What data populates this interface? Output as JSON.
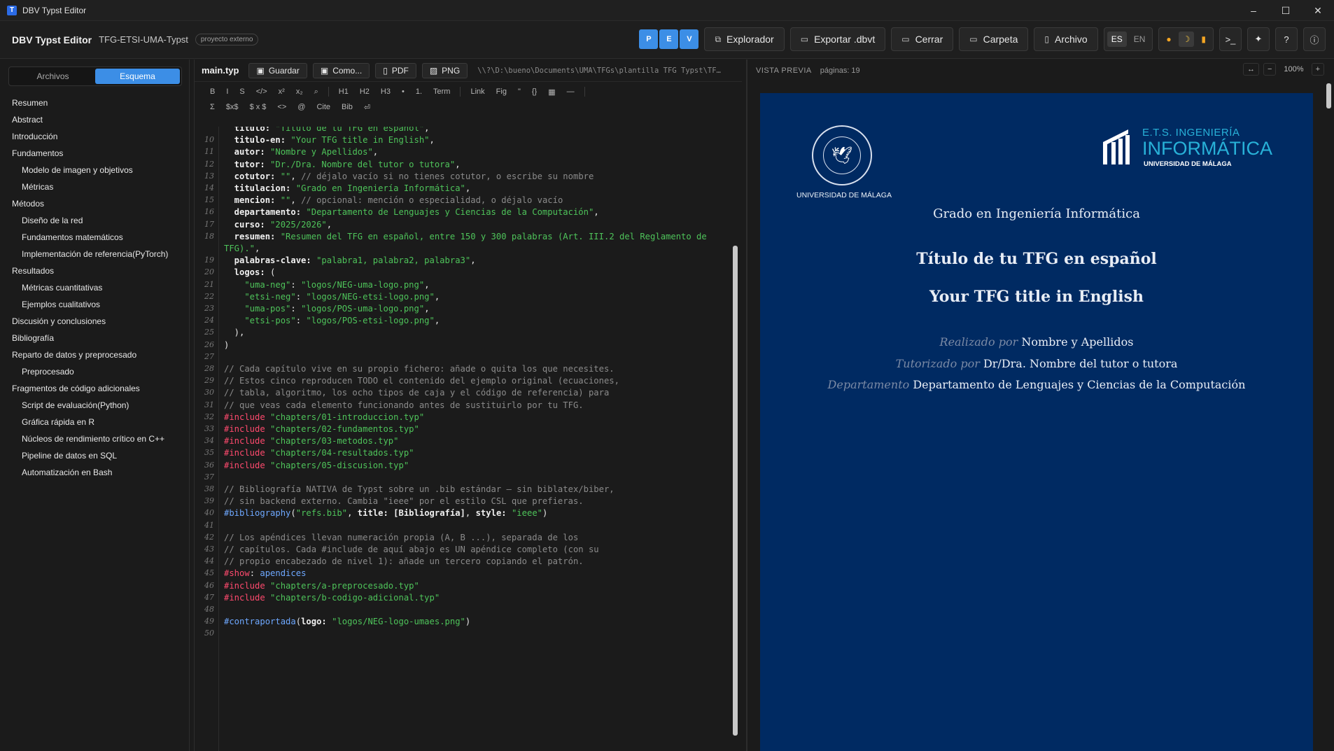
{
  "window": {
    "title": "DBV Typst Editor",
    "icon_letter": "T",
    "minimize": "–",
    "maximize": "☐",
    "close": "✕"
  },
  "toolbar": {
    "app_name": "DBV Typst Editor",
    "project": "TFG-ETSI-UMA-Typst",
    "badge": "proyecto externo",
    "pev": [
      "P",
      "E",
      "V"
    ],
    "explorer": "Explorador",
    "export": "Exportar .dbvt",
    "close": "Cerrar",
    "folder": "Carpeta",
    "file": "Archivo",
    "lang_es": "ES",
    "lang_en": "EN",
    "terminal": ">_",
    "ai": "✦",
    "help": "?",
    "info": "ⓘ"
  },
  "sidebar": {
    "tab_files": "Archivos",
    "tab_outline": "Esquema",
    "outline": [
      {
        "label": "Resumen",
        "level": 1
      },
      {
        "label": "Abstract",
        "level": 1
      },
      {
        "label": "Introducción",
        "level": 1
      },
      {
        "label": "Fundamentos",
        "level": 1
      },
      {
        "label": "Modelo de imagen y objetivos",
        "level": 2
      },
      {
        "label": "Métricas",
        "level": 2
      },
      {
        "label": "Métodos",
        "level": 1
      },
      {
        "label": "Diseño de la red",
        "level": 2
      },
      {
        "label": "Fundamentos matemáticos",
        "level": 2
      },
      {
        "label": "Implementación de referencia(PyTorch)",
        "level": 2
      },
      {
        "label": "Resultados",
        "level": 1
      },
      {
        "label": "Métricas cuantitativas",
        "level": 2
      },
      {
        "label": "Ejemplos cualitativos",
        "level": 2
      },
      {
        "label": "Discusión y conclusiones",
        "level": 1
      },
      {
        "label": "Bibliografía",
        "level": 1
      },
      {
        "label": "Reparto de datos y preprocesado",
        "level": 1
      },
      {
        "label": "Preprocesado",
        "level": 2
      },
      {
        "label": "Fragmentos de código adicionales",
        "level": 1
      },
      {
        "label": "Script de evaluación(Python)",
        "level": 2
      },
      {
        "label": "Gráfica rápida en R",
        "level": 2
      },
      {
        "label": "Núcleos de rendimiento crítico en C++",
        "level": 2
      },
      {
        "label": "Pipeline de datos en SQL",
        "level": 2
      },
      {
        "label": "Automatización en Bash",
        "level": 2
      }
    ]
  },
  "editor": {
    "filename": "main.typ",
    "save": "Guardar",
    "save_as": "Como...",
    "pdf": "PDF",
    "png": "PNG",
    "path": "\\\\?\\D:\\bueno\\Documents\\UMA\\TFGs\\plantilla TFG Typst\\TF…",
    "format_row1": [
      "B",
      "I",
      "S",
      "</>",
      "x²",
      "x₂",
      "⌕",
      "|",
      "H1",
      "H2",
      "H3",
      "•",
      "1.",
      "Term",
      "|",
      "Link",
      "Fig",
      "\"",
      "{}",
      "▦",
      "—",
      "|"
    ],
    "format_row2": [
      "Σ",
      "$x$",
      "$ x $",
      "<>",
      "@",
      "Cite",
      "Bib",
      "⏎"
    ],
    "lines": [
      {
        "n": "",
        "seg": [
          [
            "k",
            "  titulo: "
          ],
          [
            "s",
            "\"Título de tu TFG en español\""
          ],
          [
            "",
            ","
          ]
        ]
      },
      {
        "n": "10",
        "seg": [
          [
            "k",
            "  titulo-en: "
          ],
          [
            "s",
            "\"Your TFG title in English\""
          ],
          [
            "",
            ","
          ]
        ]
      },
      {
        "n": "11",
        "seg": [
          [
            "k",
            "  autor: "
          ],
          [
            "s",
            "\"Nombre y Apellidos\""
          ],
          [
            "",
            ","
          ]
        ]
      },
      {
        "n": "12",
        "seg": [
          [
            "k",
            "  tutor: "
          ],
          [
            "s",
            "\"Dr./Dra. Nombre del tutor o tutora\""
          ],
          [
            "",
            ","
          ]
        ]
      },
      {
        "n": "13",
        "seg": [
          [
            "k",
            "  cotutor: "
          ],
          [
            "s",
            "\"\""
          ],
          [
            "",
            ", "
          ],
          [
            "c",
            "// déjalo vacío si no tienes cotutor, o escribe su nombre"
          ]
        ]
      },
      {
        "n": "14",
        "seg": [
          [
            "k",
            "  titulacion: "
          ],
          [
            "s",
            "\"Grado en Ingeniería Informática\""
          ],
          [
            "",
            ","
          ]
        ]
      },
      {
        "n": "15",
        "seg": [
          [
            "k",
            "  mencion: "
          ],
          [
            "s",
            "\"\""
          ],
          [
            "",
            ", "
          ],
          [
            "c",
            "// opcional: mención o especialidad, o déjalo vacío"
          ]
        ]
      },
      {
        "n": "16",
        "seg": [
          [
            "k",
            "  departamento: "
          ],
          [
            "s",
            "\"Departamento de Lenguajes y Ciencias de la Computación\""
          ],
          [
            "",
            ","
          ]
        ]
      },
      {
        "n": "17",
        "seg": [
          [
            "k",
            "  curso: "
          ],
          [
            "s",
            "\"2025/2026\""
          ],
          [
            "",
            ","
          ]
        ]
      },
      {
        "n": "18",
        "seg": [
          [
            "k",
            "  resumen: "
          ],
          [
            "s",
            "\"Resumen del TFG en español, entre 150 y 300 palabras (Art. III.2 del Reglamento de"
          ]
        ]
      },
      {
        "n": "",
        "seg": [
          [
            "s",
            "TFG).\""
          ],
          [
            "",
            ","
          ]
        ]
      },
      {
        "n": "19",
        "seg": [
          [
            "k",
            "  palabras-clave: "
          ],
          [
            "s",
            "\"palabra1, palabra2, palabra3\""
          ],
          [
            "",
            ","
          ]
        ]
      },
      {
        "n": "20",
        "seg": [
          [
            "k",
            "  logos: "
          ],
          [
            "",
            "("
          ]
        ]
      },
      {
        "n": "21",
        "seg": [
          [
            "s",
            "    \"uma-neg\""
          ],
          [
            "",
            ": "
          ],
          [
            "s",
            "\"logos/NEG-uma-logo.png\""
          ],
          [
            "",
            ","
          ]
        ]
      },
      {
        "n": "22",
        "seg": [
          [
            "s",
            "    \"etsi-neg\""
          ],
          [
            "",
            ": "
          ],
          [
            "s",
            "\"logos/NEG-etsi-logo.png\""
          ],
          [
            "",
            ","
          ]
        ]
      },
      {
        "n": "23",
        "seg": [
          [
            "s",
            "    \"uma-pos\""
          ],
          [
            "",
            ": "
          ],
          [
            "s",
            "\"logos/POS-uma-logo.png\""
          ],
          [
            "",
            ","
          ]
        ]
      },
      {
        "n": "24",
        "seg": [
          [
            "s",
            "    \"etsi-pos\""
          ],
          [
            "",
            ": "
          ],
          [
            "s",
            "\"logos/POS-etsi-logo.png\""
          ],
          [
            "",
            ","
          ]
        ]
      },
      {
        "n": "25",
        "seg": [
          [
            "",
            "  ),"
          ]
        ]
      },
      {
        "n": "26",
        "seg": [
          [
            "",
            ")"
          ]
        ]
      },
      {
        "n": "27",
        "seg": []
      },
      {
        "n": "28",
        "seg": [
          [
            "c",
            "// Cada capítulo vive en su propio fichero: añade o quita los que necesites."
          ]
        ]
      },
      {
        "n": "29",
        "seg": [
          [
            "c",
            "// Estos cinco reproducen TODO el contenido del ejemplo original (ecuaciones,"
          ]
        ]
      },
      {
        "n": "30",
        "seg": [
          [
            "c",
            "// tabla, algoritmo, los ocho tipos de caja y el código de referencia) para"
          ]
        ]
      },
      {
        "n": "31",
        "seg": [
          [
            "c",
            "// que veas cada elemento funcionando antes de sustituirlo por tu TFG."
          ]
        ]
      },
      {
        "n": "32",
        "seg": [
          [
            "h",
            "#include "
          ],
          [
            "s",
            "\"chapters/01-introduccion.typ\""
          ]
        ]
      },
      {
        "n": "33",
        "seg": [
          [
            "h",
            "#include "
          ],
          [
            "s",
            "\"chapters/02-fundamentos.typ\""
          ]
        ]
      },
      {
        "n": "34",
        "seg": [
          [
            "h",
            "#include "
          ],
          [
            "s",
            "\"chapters/03-metodos.typ\""
          ]
        ]
      },
      {
        "n": "35",
        "seg": [
          [
            "h",
            "#include "
          ],
          [
            "s",
            "\"chapters/04-resultados.typ\""
          ]
        ]
      },
      {
        "n": "36",
        "seg": [
          [
            "h",
            "#include "
          ],
          [
            "s",
            "\"chapters/05-discusion.typ\""
          ]
        ]
      },
      {
        "n": "37",
        "seg": []
      },
      {
        "n": "38",
        "seg": [
          [
            "c",
            "// Bibliografía NATIVA de Typst sobre un .bib estándar — sin biblatex/biber,"
          ]
        ]
      },
      {
        "n": "39",
        "seg": [
          [
            "c",
            "// sin backend externo. Cambia \"ieee\" por el estilo CSL que prefieras."
          ]
        ]
      },
      {
        "n": "40",
        "seg": [
          [
            "fn",
            "#bibliography"
          ],
          [
            "",
            "("
          ],
          [
            "s",
            "\"refs.bib\""
          ],
          [
            "",
            ", "
          ],
          [
            "k",
            "title: "
          ],
          [
            "k",
            "[Bibliografía]"
          ],
          [
            "",
            ", "
          ],
          [
            "k",
            "style: "
          ],
          [
            "s",
            "\"ieee\""
          ],
          [
            "",
            ")"
          ]
        ]
      },
      {
        "n": "41",
        "seg": []
      },
      {
        "n": "42",
        "seg": [
          [
            "c",
            "// Los apéndices llevan numeración propia (A, B ...), separada de los"
          ]
        ]
      },
      {
        "n": "43",
        "seg": [
          [
            "c",
            "// capítulos. Cada #include de aquí abajo es UN apéndice completo (con su"
          ]
        ]
      },
      {
        "n": "44",
        "seg": [
          [
            "c",
            "// propio encabezado de nivel 1): añade un tercero copiando el patrón."
          ]
        ]
      },
      {
        "n": "45",
        "seg": [
          [
            "h",
            "#show"
          ],
          [
            "",
            ": "
          ],
          [
            "fn",
            "apendices"
          ]
        ]
      },
      {
        "n": "46",
        "seg": [
          [
            "h",
            "#include "
          ],
          [
            "s",
            "\"chapters/a-preprocesado.typ\""
          ]
        ]
      },
      {
        "n": "47",
        "seg": [
          [
            "h",
            "#include "
          ],
          [
            "s",
            "\"chapters/b-codigo-adicional.typ\""
          ]
        ]
      },
      {
        "n": "48",
        "seg": []
      },
      {
        "n": "49",
        "seg": [
          [
            "fn",
            "#contraportada"
          ],
          [
            "",
            "("
          ],
          [
            "k",
            "logo: "
          ],
          [
            "s",
            "\"logos/NEG-logo-umaes.png\""
          ],
          [
            "",
            ")"
          ]
        ]
      },
      {
        "n": "50",
        "seg": []
      }
    ]
  },
  "preview": {
    "label": "VISTA PREVIA",
    "pages": "páginas: 19",
    "zoom": "100%",
    "fit": "↔",
    "zoom_out": "−",
    "zoom_in": "+",
    "page_bg": "#002a62",
    "uma_name": "UNIVERSIDAD DE MÁLAGA",
    "etsi_line1": "E.T.S. INGENIERÍA",
    "etsi_line2": "INFORMÁTICA",
    "etsi_line3": "UNIVERSIDAD DE MÁLAGA",
    "grado": "Grado en Ingeniería Informática",
    "title_es": "Título de tu TFG en español",
    "title_en": "Your TFG title in English",
    "realizado_label": "Realizado por",
    "realizado_value": "Nombre y Apellidos",
    "tutorizado_label": "Tutorizado por",
    "tutorizado_value": "Dr/Dra. Nombre del tutor o tutora",
    "departamento_label": "Departamento",
    "departamento_value": "Departamento de Lenguajes y Ciencias de la Computación"
  },
  "colors": {
    "accent": "#3c8ee6",
    "string": "#4ec35a",
    "keyword_hash": "#ff4a6e",
    "function": "#6ea8ff",
    "comment": "#8b8b8b"
  }
}
